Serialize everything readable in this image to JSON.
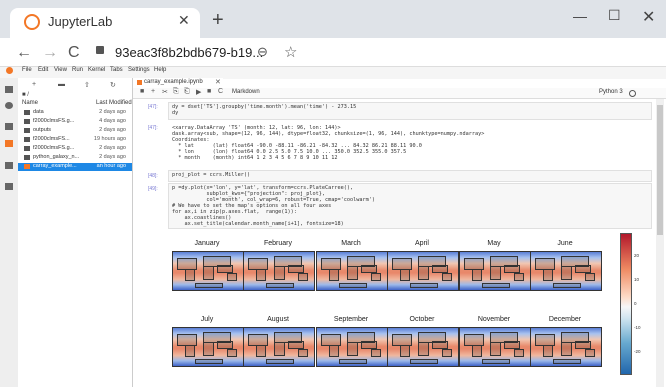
{
  "browser": {
    "tab_title": "JupyterLab",
    "tab_close": "✕",
    "new_tab": "+",
    "url": "93eac3f8b2bdb679-b19...",
    "back": "←",
    "forward": "→",
    "reload": "C",
    "zoom_icon": "⊖",
    "star_icon": "☆",
    "minimize": "—",
    "maximize": "☐",
    "close": "✕"
  },
  "menu": [
    "File",
    "Edit",
    "View",
    "Run",
    "Kernel",
    "Tabs",
    "Settings",
    "Help"
  ],
  "filebrowser": {
    "path": "■ / ",
    "col_name": "Name",
    "col_modified": "Last Modified",
    "rows": [
      {
        "name": "data",
        "modified": "2 days ago"
      },
      {
        "name": "f2000clmsFS.g...",
        "modified": "4 days ago"
      },
      {
        "name": "outputs",
        "modified": "2 days ago"
      },
      {
        "name": "f2000clmsFS...",
        "modified": "19 hours ago"
      },
      {
        "name": "f2000clmsFS.g...",
        "modified": "2 days ago"
      },
      {
        "name": "python_galaxy_n...",
        "modified": "2 days ago"
      },
      {
        "name": "carray_example...",
        "modified": "an hour ago"
      }
    ]
  },
  "notebook": {
    "tab_label": "carray_example.ipynb",
    "tab_close": "✕",
    "cell_type": "Markdown",
    "kernel": "Python 3",
    "toolbar": [
      "■",
      "+",
      "✂",
      "⎘",
      "⎗",
      "▶",
      "■",
      "C"
    ]
  },
  "cells": [
    {
      "prompt": "[47]:",
      "code": "dy = dset['TS'].groupby('time.month').mean('time') - 273.15\ndy"
    },
    {
      "prompt": "[47]:",
      "output": "<xarray.DataArray 'TS' (month: 12, lat: 96, lon: 144)>\ndask.array<sub, shape=(12, 96, 144), dtype=float32, chunksize=(1, 96, 144), chunktype=numpy.ndarray>\nCoordinates:\n  * lat      (lat) float64 -90.0 -88.11 -86.21 -84.32 ... 84.32 86.21 88.11 90.0\n  * lon      (lon) float64 0.0 2.5 5.0 7.5 10.0 ... 350.0 352.5 355.0 357.5\n  * month    (month) int64 1 2 3 4 5 6 7 8 9 10 11 12"
    },
    {
      "prompt": "[48]:",
      "code": "proj_plot = ccrs.Miller()"
    },
    {
      "prompt": "[49]:",
      "code": "p =dy.plot(x='lon', y='lat', transform=ccrs.PlateCarree(),\n           subplot_kws={\"projection\": proj_plot},\n           col='month', col_wrap=6, robust=True, cmap='coolwarm')\n# We have to set the map's options on all four axes\nfor ax,i in zip(p.axes.flat,  range(1)):\n    ax.coastlines()\n    ax.set_title(calendar.month_name[i+1], fontsize=18)"
    }
  ],
  "chart_data": {
    "type": "heatmap",
    "panels": [
      "January",
      "February",
      "March",
      "April",
      "May",
      "June",
      "July",
      "August",
      "September",
      "October",
      "November",
      "December"
    ],
    "colorbar_ticks": [
      "20",
      "10",
      "0",
      "-10",
      "-20"
    ],
    "cmap": "coolwarm"
  },
  "colors": {
    "accent": "#1e88e5",
    "brand": "#f37726"
  }
}
